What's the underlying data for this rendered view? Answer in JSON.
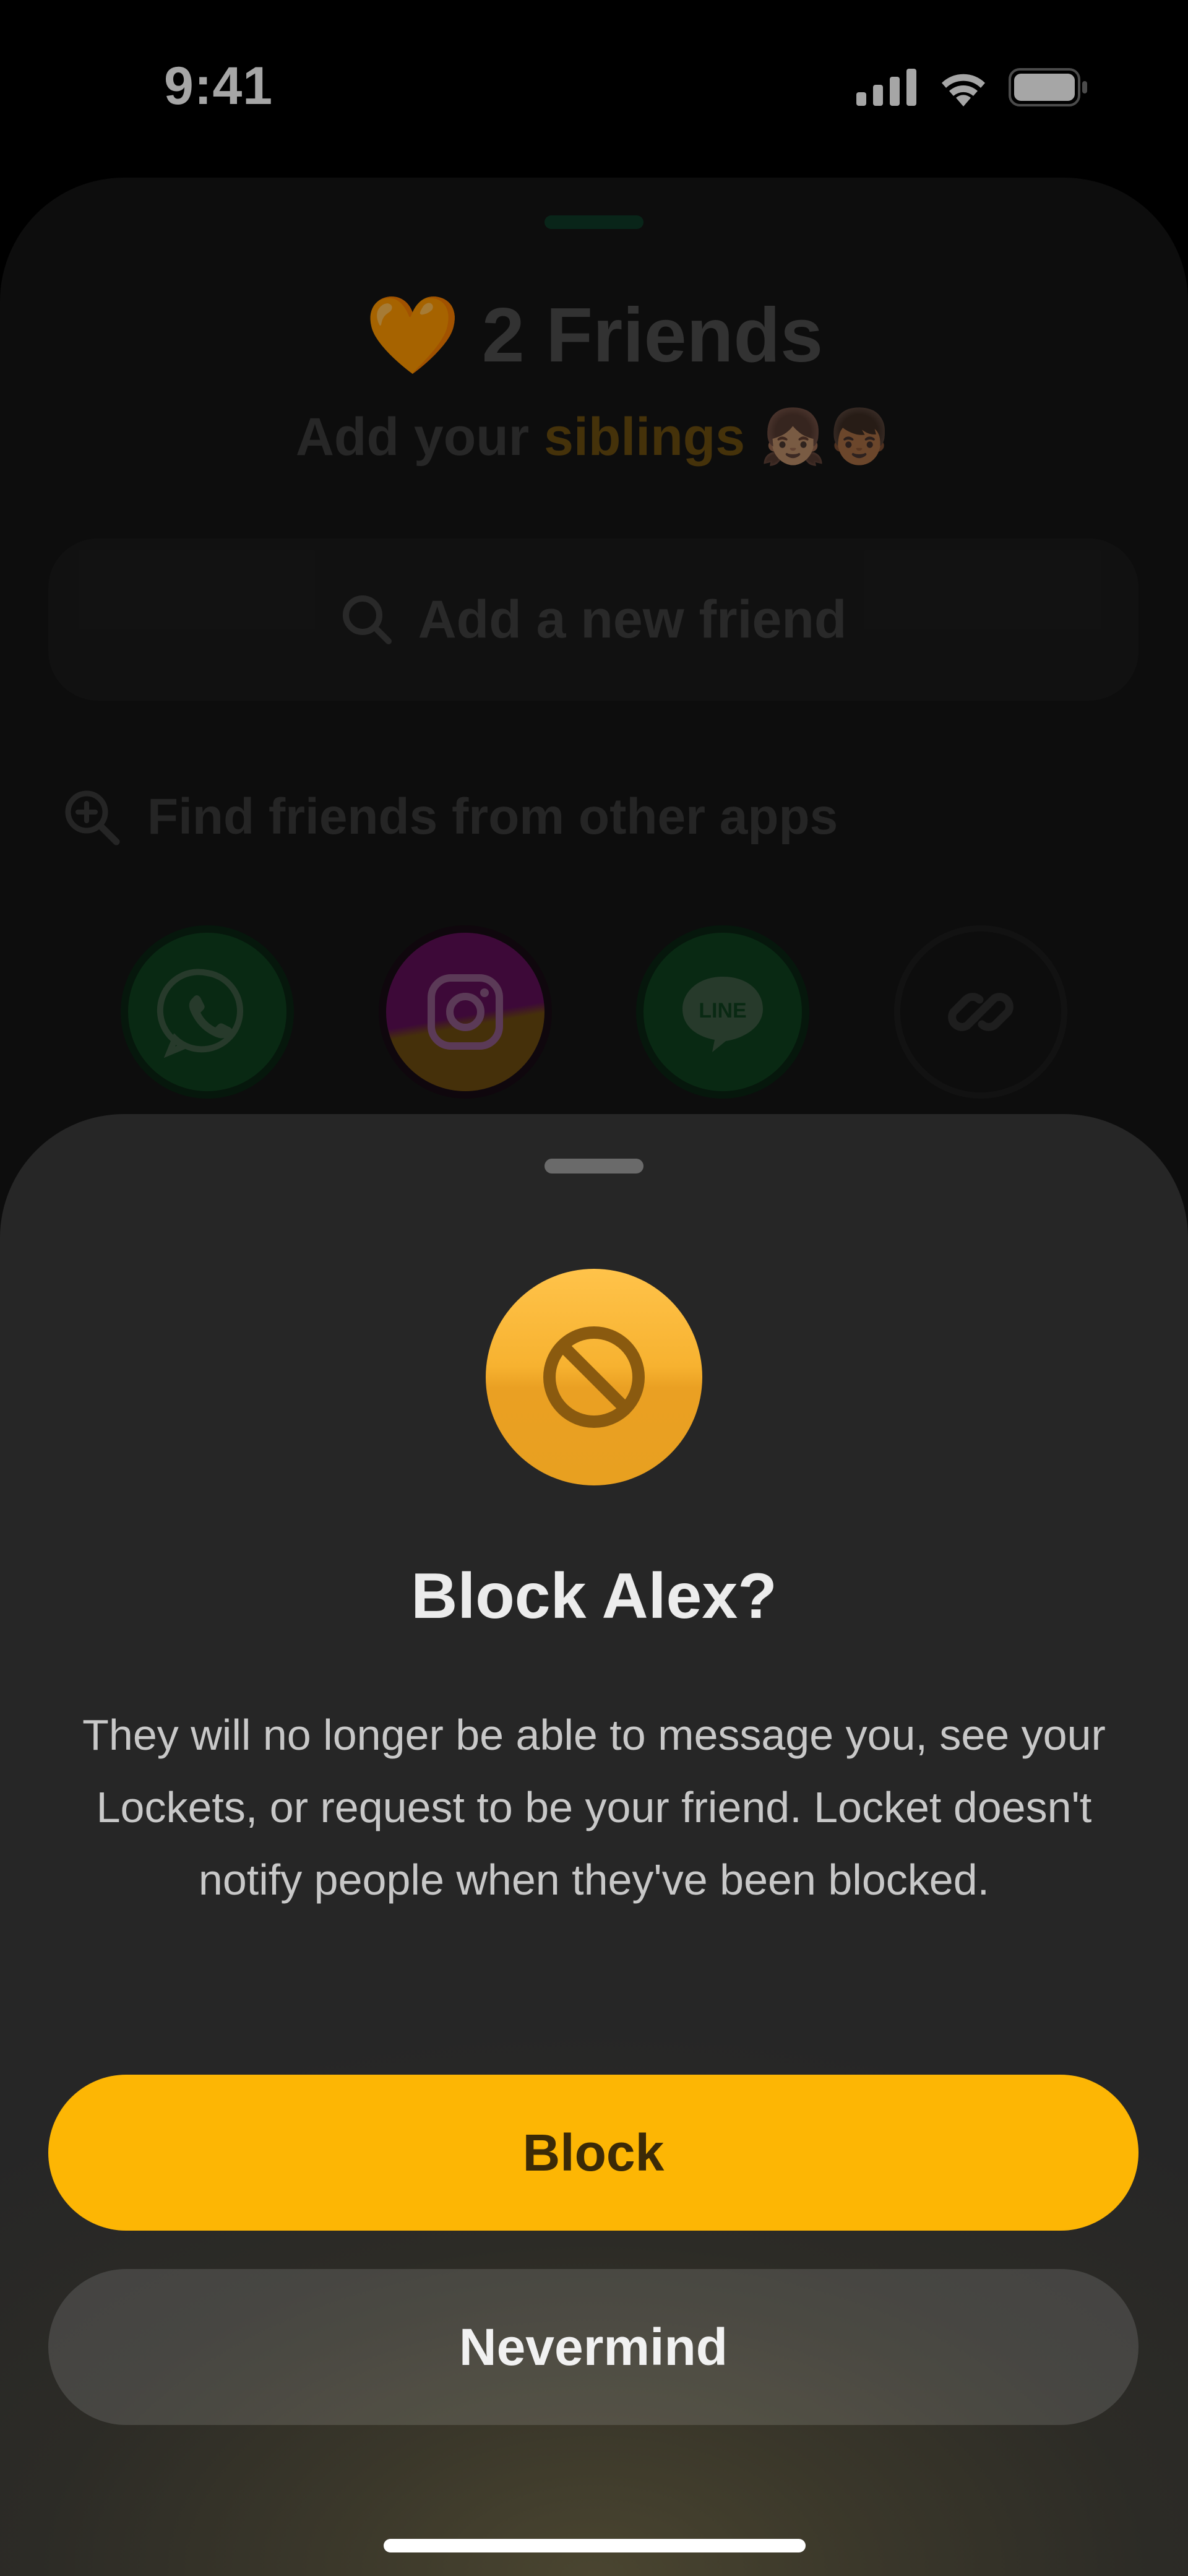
{
  "status_bar": {
    "time": "9:41"
  },
  "background": {
    "friends_count_title": "2 Friends",
    "heart_icon": "🧡",
    "subtitle_prefix": "Add your ",
    "subtitle_accent": "siblings",
    "subtitle_emoji": "👧🏽👦🏾",
    "search_placeholder": "Add a new friend",
    "find_friends_label": "Find friends from other apps",
    "apps": [
      {
        "name": "whatsapp",
        "color": "#1a8a3a"
      },
      {
        "name": "instagram",
        "color": "#b21ea6"
      },
      {
        "name": "line",
        "color": "#1e9a3c"
      },
      {
        "name": "link",
        "color": "#1d1d1d"
      }
    ]
  },
  "modal": {
    "title": "Block Alex?",
    "body": "They will no longer be able to message you, see your Lockets, or request to be your friend. Locket doesn't notify people when they've been blocked.",
    "block_label": "Block",
    "nevermind_label": "Nevermind",
    "accent_color": "#fdb604"
  }
}
